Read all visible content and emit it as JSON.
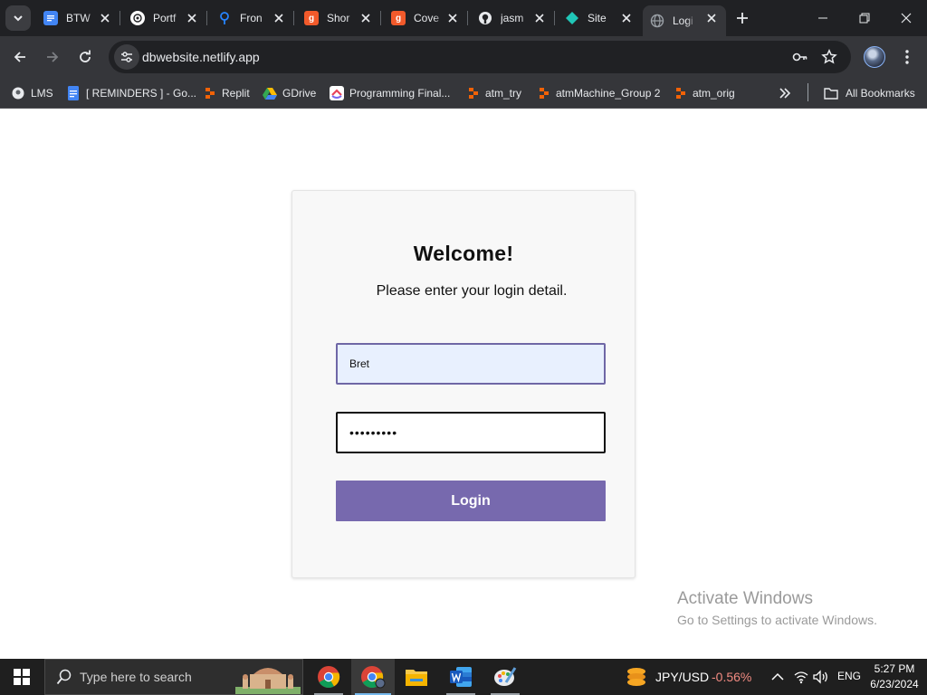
{
  "browser": {
    "tabs": [
      {
        "label": "BTW",
        "favicon": "google-docs-icon",
        "color": "#4285f4",
        "active": false
      },
      {
        "label": "Portf",
        "favicon": "chatgpt-icon",
        "color": "#ffffff",
        "active": false
      },
      {
        "label": "Fron",
        "favicon": "sourcetree-icon",
        "color": "#2684ff",
        "active": false
      },
      {
        "label": "Shor",
        "favicon": "g-icon",
        "color": "#f25a2b",
        "active": false
      },
      {
        "label": "Cove",
        "favicon": "g-icon",
        "color": "#f25a2b",
        "active": false
      },
      {
        "label": "jasm",
        "favicon": "github-icon",
        "color": "#ffffff",
        "active": false
      },
      {
        "label": "Site",
        "favicon": "netlify-icon",
        "color": "#20c6b7",
        "active": false
      },
      {
        "label": "Logi",
        "favicon": "globe-icon",
        "color": "#9aa0a6",
        "active": true
      }
    ],
    "url": "dbwebsite.netlify.app",
    "bookmarks": [
      {
        "label": "LMS",
        "icon": "lms-icon"
      },
      {
        "label": "[ REMINDERS ] - Go...",
        "icon": "google-docs-icon"
      },
      {
        "label": "Replit",
        "icon": "replit-icon"
      },
      {
        "label": "GDrive",
        "icon": "google-drive-icon"
      },
      {
        "label": "Programming Final...",
        "icon": "clickup-icon"
      },
      {
        "label": "atm_try",
        "icon": "replit-icon"
      },
      {
        "label": "atmMachine_Group 2",
        "icon": "replit-icon"
      },
      {
        "label": "atm_orig",
        "icon": "replit-icon"
      }
    ],
    "all_bookmarks_label": "All Bookmarks"
  },
  "login": {
    "title": "Welcome!",
    "subtitle": "Please enter your login detail.",
    "username_value": "Bret",
    "password_value": "•••••••••",
    "button_label": "Login",
    "accent": "#7769ae"
  },
  "watermark": {
    "line1": "Activate Windows",
    "line2": "Go to Settings to activate Windows."
  },
  "taskbar": {
    "search_placeholder": "Type here to search",
    "ticker_symbol": "JPY/USD",
    "ticker_change": "-0.56%",
    "ticker_color": "#f28b82",
    "language": "ENG",
    "time": "5:27 PM",
    "date": "6/23/2024"
  }
}
